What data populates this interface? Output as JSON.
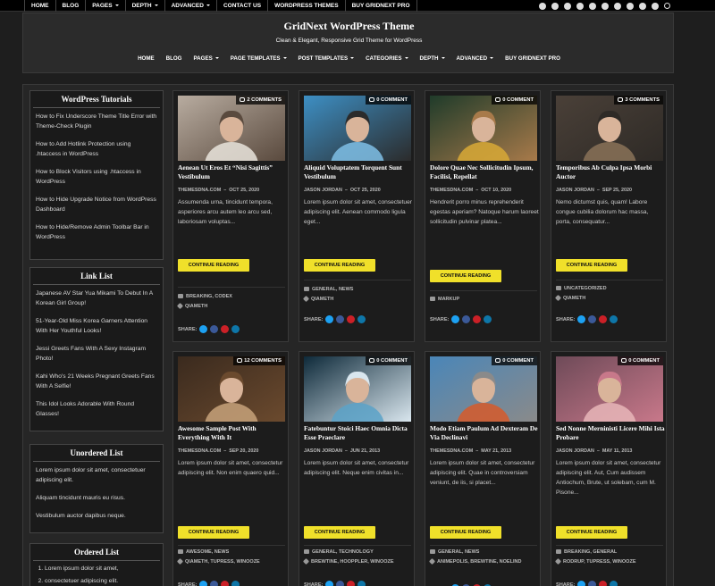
{
  "topbar": {
    "items": [
      {
        "label": "HOME",
        "caret": false
      },
      {
        "label": "BLOG",
        "caret": false
      },
      {
        "label": "PAGES",
        "caret": true
      },
      {
        "label": "DEPTH",
        "caret": true
      },
      {
        "label": "ADVANCED",
        "caret": true
      },
      {
        "label": "CONTACT US",
        "caret": false
      },
      {
        "label": "WORDPRESS THEMES",
        "caret": false
      },
      {
        "label": "BUY GRIDNEXT PRO",
        "caret": false
      }
    ],
    "social_icons": [
      "twitter-icon",
      "facebook-icon",
      "pinterest-icon",
      "linkedin-icon",
      "instagram-icon",
      "youtube-icon",
      "messenger-icon",
      "whatsapp-icon",
      "vk-icon",
      "rss-icon",
      "search-icon"
    ]
  },
  "header": {
    "site_title": "GridNext WordPress Theme",
    "tagline": "Clean & Elegant, Responsive Grid Theme for WordPress",
    "nav": [
      {
        "label": "HOME",
        "caret": false
      },
      {
        "label": "BLOG",
        "caret": false
      },
      {
        "label": "PAGES",
        "caret": true
      },
      {
        "label": "PAGE TEMPLATES",
        "caret": true
      },
      {
        "label": "POST TEMPLATES",
        "caret": true
      },
      {
        "label": "CATEGORIES",
        "caret": true
      },
      {
        "label": "DEPTH",
        "caret": true
      },
      {
        "label": "ADVANCED",
        "caret": true
      },
      {
        "label": "BUY GRIDNEXT PRO",
        "caret": false
      }
    ]
  },
  "sidebar": {
    "tutorials": {
      "title": "WordPress Tutorials",
      "items": [
        "How to Fix Underscore Theme Title Error with Theme-Check Plugin",
        "How to Add Hotlink Protection using .htaccess in WordPress",
        "How to Block Visitors using .htaccess in WordPress",
        "How to Hide Upgrade Notice from WordPress Dashboard",
        "How to Hide/Remove Admin Toolbar Bar in WordPress"
      ]
    },
    "links": {
      "title": "Link List",
      "items": [
        "Japanese AV Star Yua Mikami To Debut In A Korean Girl Group!",
        "51-Year-Old Miss Korea Garners Attention With Her Youthful Looks!",
        "Jessi Greets Fans With A Sexy Instagram Photo!",
        "Kahi Who's 21 Weeks Pregnant Greets Fans With A Selfie!",
        "This Idol Looks Adorable With Round Glasses!"
      ]
    },
    "unordered": {
      "title": "Unordered List",
      "items": [
        "Lorem ipsum dolor sit amet, consectetuer adipiscing elit.",
        "Aliquam tincidunt mauris eu risus.",
        "Vestibulum auctor dapibus neque."
      ]
    },
    "ordered": {
      "title": "Ordered List",
      "items": [
        "Lorem ipsum dolor sit amet,",
        "consectetuer adipiscing elit."
      ]
    }
  },
  "labels": {
    "read_more": "CONTINUE READING",
    "share": "SHARE:"
  },
  "posts": [
    {
      "comments": "2 COMMENTS",
      "title": "Aenean Ut Eros Et “Nisi Sagittis” Vestibulum",
      "author": "THEMESDNA.COM",
      "date": "OCT 25, 2020",
      "excerpt": "Assumenda urna, tincidunt tempora, asperiores arcu autem leo arcu sed, laboriosam voluptas...",
      "cats": "BREAKING, CODEX",
      "tags": "QIAMETH",
      "colors": [
        "#b8aca0",
        "#e9e4dc",
        "#5a4a3e"
      ]
    },
    {
      "comments": "0 COMMENT",
      "title": "Aliquid Voluptatem Torquent Sunt Vestibulum",
      "author": "JASON JORDAN",
      "date": "OCT 25, 2020",
      "excerpt": "Lorem ipsum dolor sit amet, consectetuer adipiscing elit. Aenean commodo ligula eget...",
      "cats": "GENERAL, NEWS",
      "tags": "QIAMETH",
      "colors": [
        "#3d8fc4",
        "#7fc0e6",
        "#2b2b2b"
      ]
    },
    {
      "comments": "0 COMMENT",
      "title": "Dolore Quae Nec Sollicitudin Ipsum, Facilisi, Repellat",
      "author": "THEMESDNA.COM",
      "date": "OCT 10, 2020",
      "excerpt": "Hendrerit porro minus reprehenderit egestas aperiam? Natoque harum laoreet sollicitudin pulvinar platea...",
      "cats": "MARKUP",
      "tags": "",
      "colors": [
        "#1f3b2a",
        "#d8a936",
        "#a87a4a"
      ]
    },
    {
      "comments": "3 COMMENTS",
      "title": "Temporibus Ab Culpa Ipsa Morbi Auctor",
      "author": "JASON JORDAN",
      "date": "SEP 25, 2020",
      "excerpt": "Nemo dictumst quis, quam! Labore congue cubilia dolorum hac massa, porta, consequatur...",
      "cats": "UNCATEGORIZED",
      "tags": "QIAMETH",
      "colors": [
        "#4a4038",
        "#8a7258",
        "#2e2a26"
      ]
    },
    {
      "comments": "12 COMMENTS",
      "title": "Awesome Sample Post With Everything With It",
      "author": "THEMESDNA.COM",
      "date": "SEP 20, 2020",
      "excerpt": "Lorem ipsum dolor sit amet, consectetur adipiscing elit. Non enim quaero quid...",
      "cats": "AWESOME, NEWS",
      "tags": "QIAMETH, TUPRESS, WINOOZE",
      "colors": [
        "#3a2a1e",
        "#c7a27a",
        "#6b4a2e"
      ]
    },
    {
      "comments": "0 COMMENT",
      "title": "Fatebuntur Stoici Haec Omnia Dicta Esse Praeclare",
      "author": "JASON JORDAN",
      "date": "JUN 21, 2013",
      "excerpt": "Lorem ipsum dolor sit amet, consectetur adipiscing elit. Neque enim civitas in...",
      "cats": "GENERAL, TECHNOLOGY",
      "tags": "BREWTINE, HOOPPLER, WINOOZE",
      "colors": [
        "#0e2a3a",
        "#5aa2c8",
        "#d9e6ee"
      ]
    },
    {
      "comments": "0 COMMENT",
      "title": "Modo Etiam Paulum Ad Dexteram De Via Declinavi",
      "author": "THEMESDNA.COM",
      "date": "MAY 21, 2013",
      "excerpt": "Lorem ipsum dolor sit amet, consectetur adipiscing elit. Quae in controversiam veniunt, de iis, si placet...",
      "cats": "GENERAL, NEWS",
      "tags": "ANIMEPOLIS, BREWTINE, NOELIND",
      "colors": [
        "#4a86b8",
        "#d65a2a",
        "#8a8a8a"
      ]
    },
    {
      "comments": "0 COMMENT",
      "title": "Sed Nonne Merninisti Licere Mihi Ista Probare",
      "author": "JASON JORDAN",
      "date": "MAY 11, 2013",
      "excerpt": "Lorem ipsum dolor sit amet, consectetur adipiscing elit. Aut, Cum audissem Antiochum, Brute, ut solebam, cum M. Pisone...",
      "cats": "BREAKING, GENERAL",
      "tags": "RODRUP, TUPRESS, WINOOZE",
      "colors": [
        "#6e4a58",
        "#e8b6b8",
        "#c8788a"
      ]
    }
  ]
}
